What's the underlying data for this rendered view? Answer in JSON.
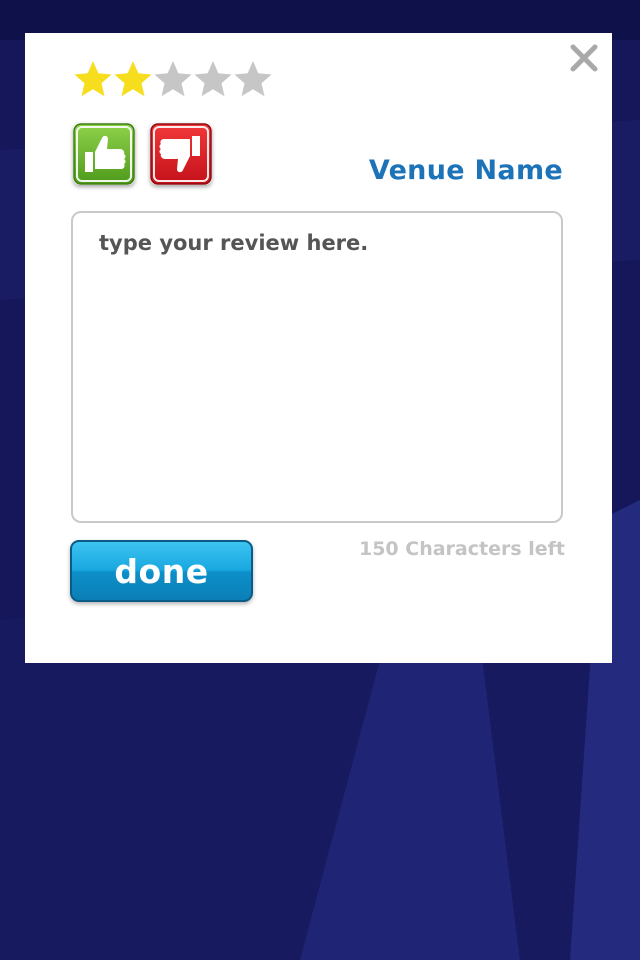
{
  "review": {
    "rating": 2,
    "max_rating": 5,
    "venue_name": "Venue Name",
    "placeholder": "type your review here.",
    "text": "",
    "characters_left_label": "150 Characters left",
    "done_label": "done"
  },
  "icons": {
    "close": "close-x-icon",
    "star": "star-icon",
    "thumbs_up": "thumbs-up-icon",
    "thumbs_down": "thumbs-down-icon"
  },
  "colors": {
    "background": "#15175a",
    "star_filled": "#f6dd1d",
    "star_empty": "#c6c6c6",
    "thumbs_up": "#6cba2b",
    "thumbs_down": "#e01b1f",
    "venue_name": "#1c73b8",
    "done_button": "#1aa8e0",
    "char_count": "#c4c4c4"
  }
}
